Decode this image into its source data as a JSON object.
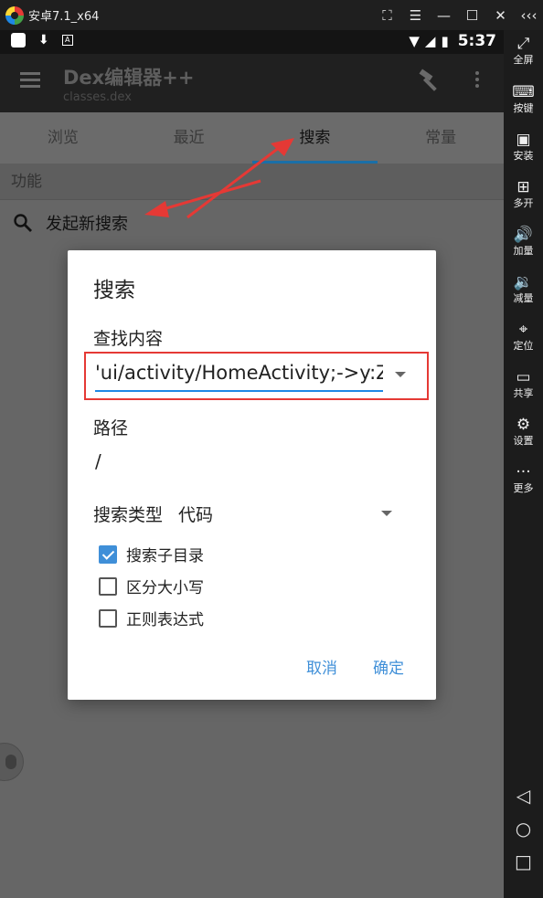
{
  "emulator": {
    "title": "安卓7.1_x64",
    "controls": [
      "⛶",
      "☰",
      "—",
      "☐",
      "✕",
      "‹‹‹"
    ],
    "sidebar": [
      {
        "icon": "⤢",
        "label": "全屏"
      },
      {
        "icon": "⌨",
        "label": "按键"
      },
      {
        "icon": "▣",
        "label": "安装"
      },
      {
        "icon": "⊞",
        "label": "多开"
      },
      {
        "icon": "🔊",
        "label": "加量"
      },
      {
        "icon": "🔉",
        "label": "减量"
      },
      {
        "icon": "⌖",
        "label": "定位"
      },
      {
        "icon": "▭",
        "label": "共享"
      },
      {
        "icon": "⚙",
        "label": "设置"
      },
      {
        "icon": "···",
        "label": "更多"
      }
    ],
    "nav": {
      "back": "◁",
      "home": "○",
      "recents": "□"
    }
  },
  "statusbar": {
    "download_icon": "⬇",
    "a_icon": "A",
    "wifi_icon": "▼",
    "signal_icon": "◢",
    "battery_icon": "▮",
    "time": "5:37"
  },
  "appbar": {
    "title": "Dex编辑器++",
    "subtitle": "classes.dex"
  },
  "tabs": [
    {
      "label": "浏览"
    },
    {
      "label": "最近"
    },
    {
      "label": "搜索"
    },
    {
      "label": "常量"
    }
  ],
  "section": {
    "header": "功能"
  },
  "list": {
    "new_search": "发起新搜索"
  },
  "dialog": {
    "title": "搜索",
    "find_label": "查找内容",
    "query_value": "'ui/activity/HomeActivity;->y:Z",
    "path_label": "路径",
    "path_value": "/",
    "type_label": "搜索类型",
    "type_value": "代码",
    "options": [
      {
        "label": "搜索子目录",
        "checked": true
      },
      {
        "label": "区分大小写",
        "checked": false
      },
      {
        "label": "正则表达式",
        "checked": false
      }
    ],
    "cancel": "取消",
    "ok": "确定"
  },
  "colors": {
    "accent": "#3f8fd8",
    "annotation": "#e53935",
    "dim_overlay": "#666666"
  }
}
